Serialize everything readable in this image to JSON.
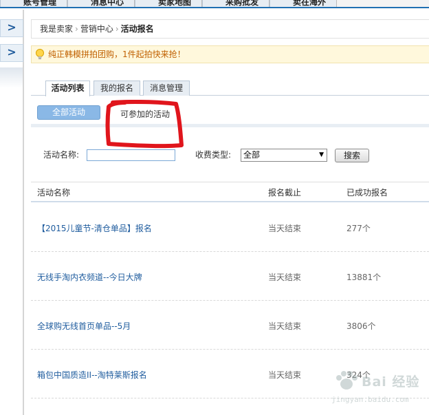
{
  "top_nav": {
    "tabs": [
      "账号管理",
      "消息中心",
      "卖家地图",
      "采购批发",
      "卖在海外"
    ]
  },
  "left_rail": {
    "expand_glyph": "&gt;"
  },
  "breadcrumb": {
    "items": [
      "我是卖家",
      "营销中心"
    ],
    "current": "活动报名",
    "separator": "›"
  },
  "notice": {
    "text": "纯正韩模拼拍团购，1件起拍快来抢！"
  },
  "tabs": [
    {
      "label": "活动列表",
      "active": true
    },
    {
      "label": "我的报名",
      "active": false
    },
    {
      "label": "消息管理",
      "active": false
    }
  ],
  "filters": {
    "all_label": "全部活动",
    "joinable_label": "可参加的活动"
  },
  "search": {
    "name_label": "活动名称:",
    "name_value": "",
    "fee_label": "收费类型:",
    "fee_selected": "全部",
    "button_label": "搜索"
  },
  "table": {
    "headers": [
      "活动名称",
      "报名截止",
      "已成功报名"
    ],
    "rows": [
      {
        "name": "【2015儿童节-清仓单品】报名",
        "deadline": "当天结束",
        "count": "277个"
      },
      {
        "name": "无线手淘内衣频道--今日大牌",
        "deadline": "当天结束",
        "count": "13881个"
      },
      {
        "name": "全球购无线首页单品--5月",
        "deadline": "当天结束",
        "count": "3806个"
      },
      {
        "name": "箱包中国质造II--淘特莱斯报名",
        "deadline": "当天结束",
        "count": "324个"
      }
    ]
  },
  "watermark": {
    "text": "Bai 经验",
    "sub": "jingyan.baidu.com"
  },
  "colors": {
    "accent": "#1f6fb2",
    "link": "#1f5c9e",
    "notice_bg": "#fff8dc",
    "notice_text": "#c06000",
    "pill_bg": "#8ab8e6",
    "annotation_red": "#e0151c"
  },
  "icons": [
    "chevron-right-icon",
    "lightbulb-icon",
    "dropdown-arrow-icon"
  ]
}
